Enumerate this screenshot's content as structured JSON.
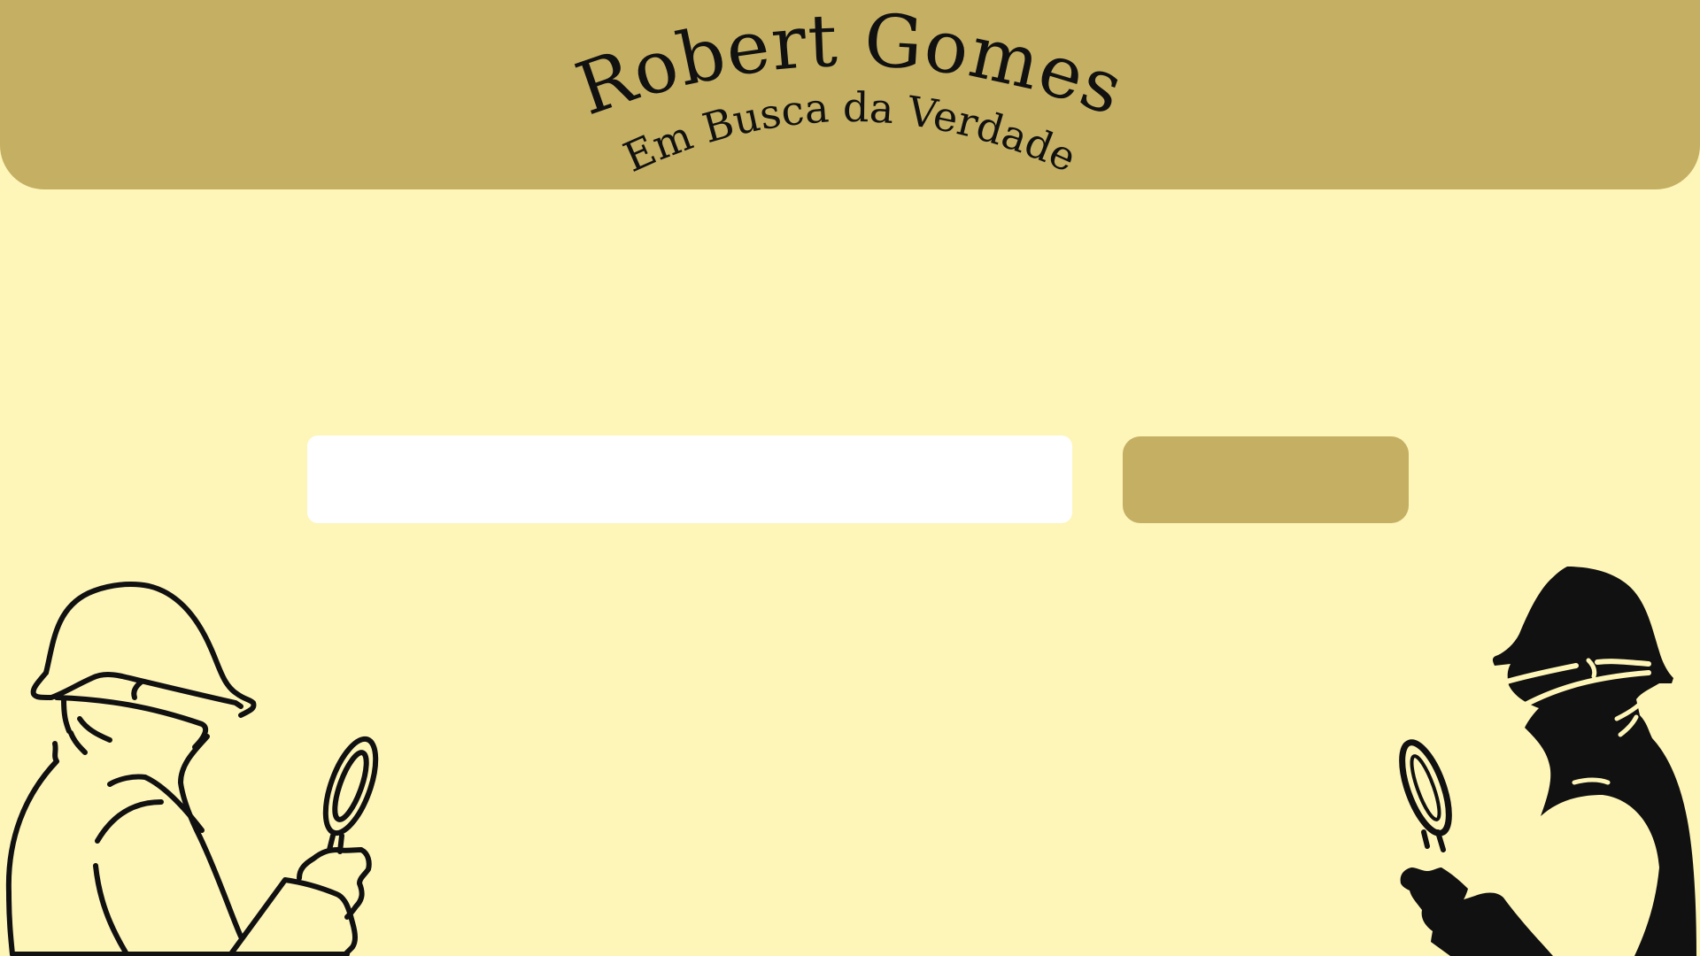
{
  "header": {
    "title": "Robert Gomes",
    "subtitle": "Em Busca da Verdade"
  },
  "search": {
    "value": "",
    "placeholder": "",
    "button_label": ""
  },
  "colors": {
    "background": "#FEF5B8",
    "header": "#C4AF63",
    "button": "#C4AF63",
    "input": "#FFFFFF",
    "ink": "#111111"
  },
  "illustrations": {
    "left": "detective-outline-icon",
    "right": "detective-silhouette-icon"
  }
}
